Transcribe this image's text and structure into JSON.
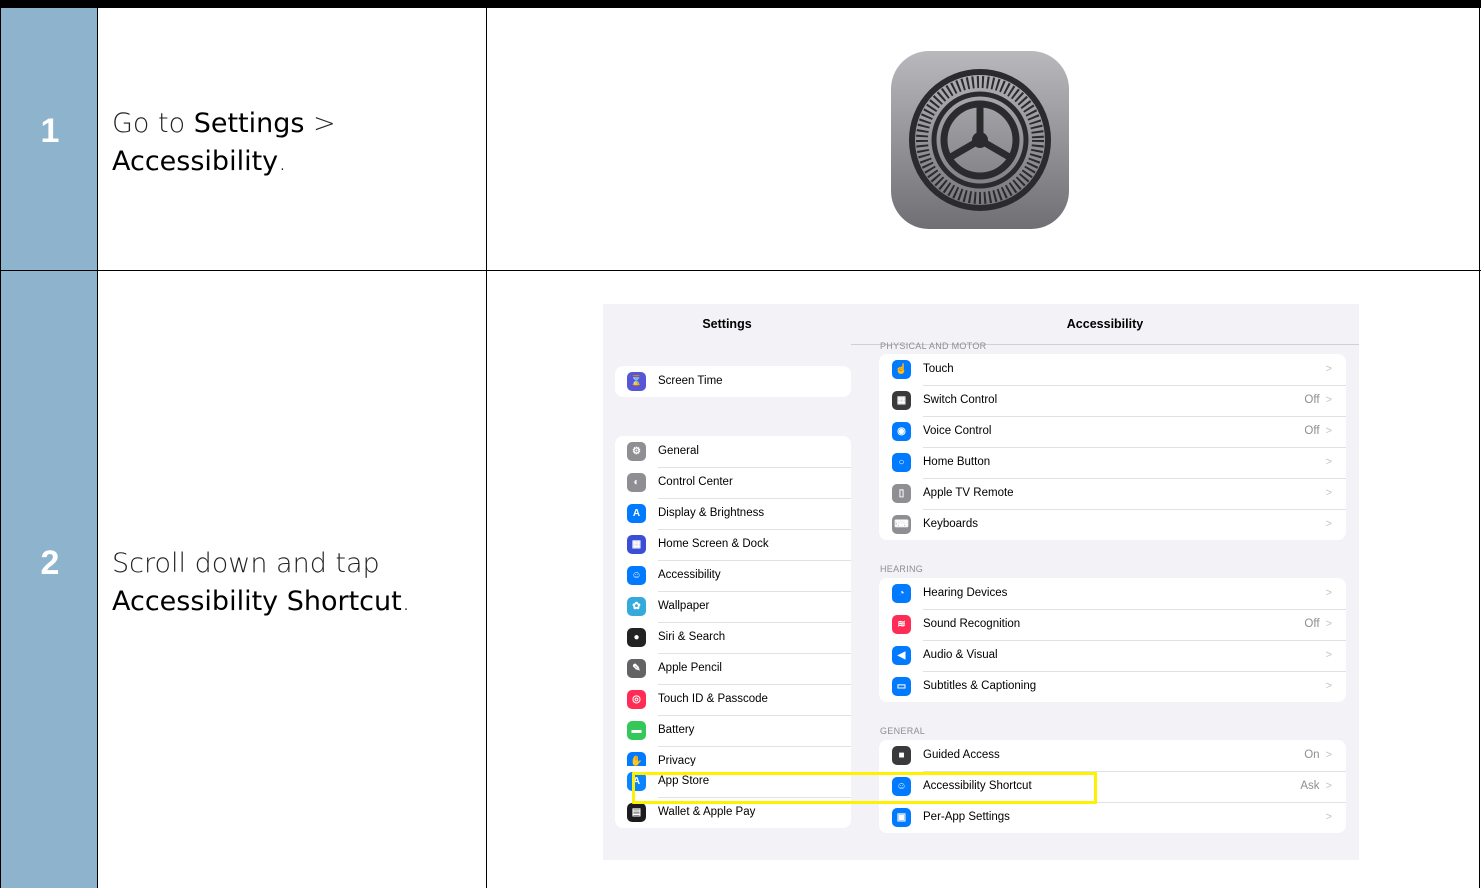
{
  "steps": [
    {
      "number": "1",
      "parts": [
        "Go to ",
        "Settings",
        " >",
        "Accessibility",
        "."
      ]
    },
    {
      "number": "2",
      "parts": [
        "Scroll down and tap",
        "Accessibility Shortcut",
        "."
      ]
    }
  ],
  "ipad": {
    "sidebar_title": "Settings",
    "detail_title": "Accessibility",
    "sidebar_groups": [
      [
        {
          "label": "Screen Time",
          "icon": "hourglass-icon",
          "color": "#5856d6"
        }
      ],
      [
        {
          "label": "General",
          "icon": "gear-icon",
          "color": "#8e8e93"
        },
        {
          "label": "Control Center",
          "icon": "toggles-icon",
          "color": "#8e8e93"
        },
        {
          "label": "Display & Brightness",
          "icon": "text-size-icon",
          "color": "#007aff"
        },
        {
          "label": "Home Screen & Dock",
          "icon": "grid-icon",
          "color": "#3a4fd6"
        },
        {
          "label": "Accessibility",
          "icon": "accessibility-icon",
          "color": "#007aff"
        },
        {
          "label": "Wallpaper",
          "icon": "flower-icon",
          "color": "#34aadc"
        },
        {
          "label": "Siri & Search",
          "icon": "siri-icon",
          "color": "#222222"
        },
        {
          "label": "Apple Pencil",
          "icon": "pencil-icon",
          "color": "#636366"
        },
        {
          "label": "Touch ID & Passcode",
          "icon": "fingerprint-icon",
          "color": "#ff2d55"
        },
        {
          "label": "Battery",
          "icon": "battery-icon",
          "color": "#34c759"
        },
        {
          "label": "Privacy",
          "icon": "hand-icon",
          "color": "#007aff"
        }
      ],
      [
        {
          "label": "App Store",
          "icon": "app-store-icon",
          "color": "#0a84ff"
        },
        {
          "label": "Wallet & Apple Pay",
          "icon": "wallet-icon",
          "color": "#1c1c1e"
        }
      ]
    ],
    "sections": [
      {
        "title": "PHYSICAL AND MOTOR",
        "items": [
          {
            "label": "Touch",
            "value": "",
            "icon": "touch-hand-icon",
            "color": "#007aff"
          },
          {
            "label": "Switch Control",
            "value": "Off",
            "icon": "switch-grid-icon",
            "color": "#3a3a3c"
          },
          {
            "label": "Voice Control",
            "value": "Off",
            "icon": "voice-control-icon",
            "color": "#007aff"
          },
          {
            "label": "Home Button",
            "value": "",
            "icon": "home-button-icon",
            "color": "#007aff"
          },
          {
            "label": "Apple TV Remote",
            "value": "",
            "icon": "remote-icon",
            "color": "#8e8e93"
          },
          {
            "label": "Keyboards",
            "value": "",
            "icon": "keyboard-icon",
            "color": "#8e8e93"
          }
        ]
      },
      {
        "title": "HEARING",
        "items": [
          {
            "label": "Hearing Devices",
            "value": "",
            "icon": "ear-icon",
            "color": "#007aff"
          },
          {
            "label": "Sound Recognition",
            "value": "Off",
            "icon": "waveform-icon",
            "color": "#ff2d55"
          },
          {
            "label": "Audio & Visual",
            "value": "",
            "icon": "speaker-icon",
            "color": "#007aff"
          },
          {
            "label": "Subtitles & Captioning",
            "value": "",
            "icon": "captions-icon",
            "color": "#007aff"
          }
        ]
      },
      {
        "title": "GENERAL",
        "items": [
          {
            "label": "Guided Access",
            "value": "On",
            "icon": "lock-icon",
            "color": "#3a3a3c"
          },
          {
            "label": "Accessibility Shortcut",
            "value": "Ask",
            "icon": "accessibility-icon",
            "color": "#007aff"
          },
          {
            "label": "Per-App Settings",
            "value": "",
            "icon": "per-app-icon",
            "color": "#007aff"
          }
        ]
      }
    ],
    "chevron": ">",
    "highlight_color": "#fff200"
  }
}
